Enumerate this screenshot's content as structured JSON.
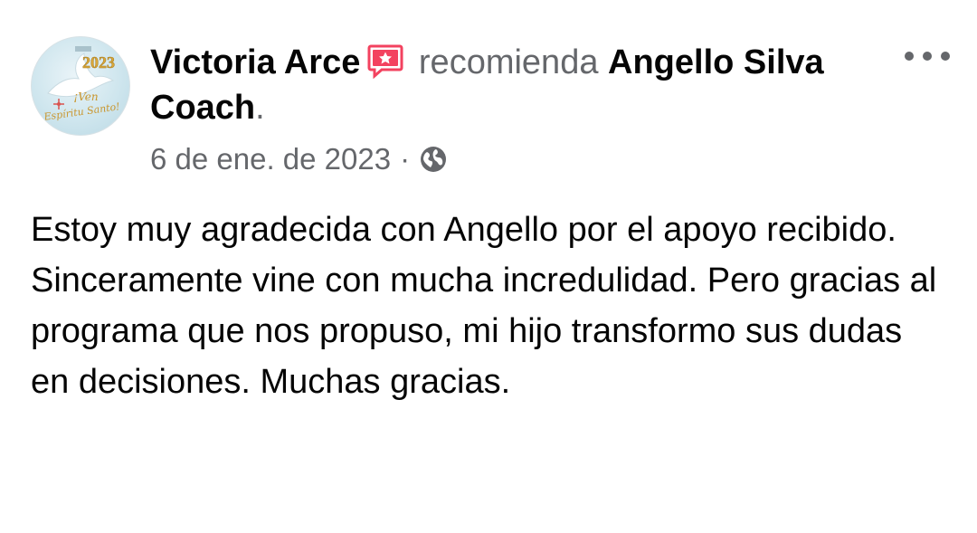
{
  "post": {
    "author_name": "Victoria Arce",
    "verb": "recomienda",
    "page_name": "Angello Silva Coach",
    "period": ".",
    "date": "6 de ene. de 2023",
    "separator": "·",
    "privacy_icon": "globe-icon",
    "recommend_icon": "recommend-star-icon",
    "more_icon": "more-options-icon",
    "body_paragraphs": [
      "Estoy muy agradecida con Angello por el apoyo recibido.",
      "Sinceramente vine con mucha incredulidad. Pero gracias al programa que nos propuso, mi hijo transformo sus dudas en decisiones. Muchas gracias."
    ],
    "avatar": {
      "year_text": "2023",
      "caption_line1": "¡Ven",
      "caption_line2": "Espíritu Santo!"
    }
  },
  "colors": {
    "text_primary": "#050505",
    "text_secondary": "#65676b",
    "recommend_icon": "#f3425f",
    "avatar_year": "#d9a73a"
  }
}
